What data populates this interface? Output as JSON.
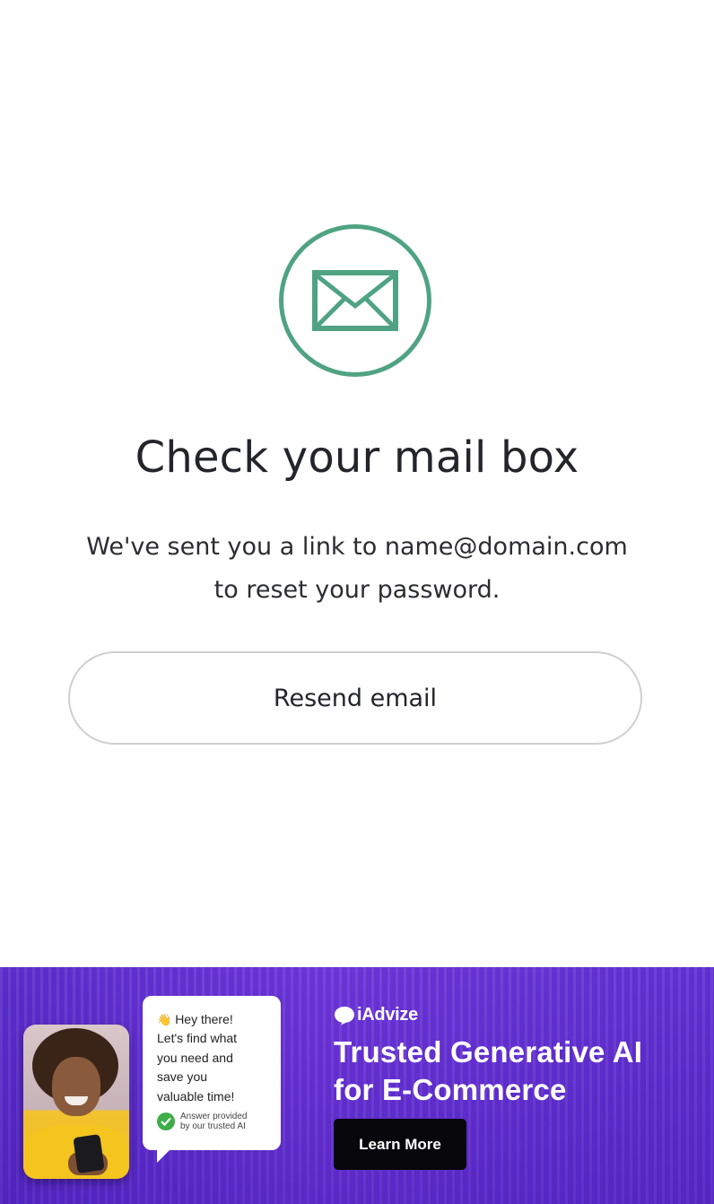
{
  "reset_confirmation": {
    "icon": "envelope-icon",
    "accent_color": "#4fa383",
    "title": "Check your mail box",
    "message_line1": "We've sent you a link to name@domain.com",
    "message_line2": "to reset your password.",
    "resend_button_label": "Resend email"
  },
  "ad_banner": {
    "brand_name": "iAdvize",
    "brand_icon": "speech-bubble-icon",
    "headline_line1": "Trusted Generative AI",
    "headline_line2": "for E-Commerce",
    "cta_label": "Learn More",
    "background_color": "#6a33d6",
    "chat": {
      "greeting_icon": "waving-hand-icon",
      "greeting": "Hey there!",
      "lines": [
        "Let's find what",
        "you need and",
        "save you",
        "valuable time!"
      ],
      "verified_icon": "check-circle-icon",
      "footnote_line1": "Answer provided",
      "footnote_line2": "by our trusted AI"
    }
  }
}
